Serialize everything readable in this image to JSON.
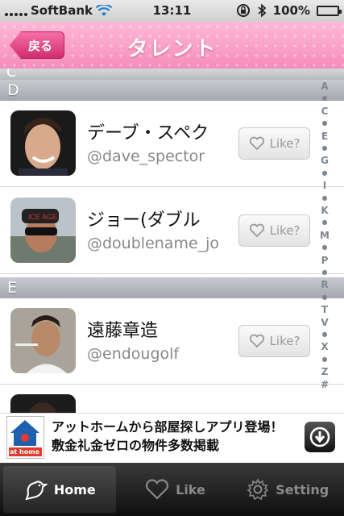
{
  "status_bar": {
    "carrier": "SoftBank",
    "time": "13:11",
    "battery": "100%"
  },
  "nav": {
    "back_label": "戻る",
    "title": "タレント"
  },
  "sections": [
    {
      "letter": "C"
    },
    {
      "letter": "D"
    },
    {
      "letter": "E"
    }
  ],
  "rows": [
    {
      "name": "デーブ・スペク",
      "handle": "@dave_spector",
      "like_label": "Like?"
    },
    {
      "name": "ジョー(ダブル",
      "handle": "@doublename_jo",
      "like_label": "Like?"
    },
    {
      "name": "遠藤章造",
      "handle": "@endougolf",
      "like_label": "Like?"
    }
  ],
  "index_letters": [
    "A",
    "●",
    "C",
    "●",
    "E",
    "●",
    "G",
    "●",
    "I",
    "●",
    "K",
    "●",
    "M",
    "●",
    "P",
    "●",
    "R",
    "●",
    "T",
    "V",
    "●",
    "X",
    "●",
    "Z",
    "#"
  ],
  "ad": {
    "text": "アットホームから部屋探しアプリ登場！敷金礼金ゼロの物件多数掲載",
    "logo_text": "at home"
  },
  "tabs": [
    {
      "label": "Home",
      "icon": "bird-icon",
      "active": true
    },
    {
      "label": "Like",
      "icon": "heart-icon",
      "active": false
    },
    {
      "label": "Setting",
      "icon": "gear-icon",
      "active": false
    }
  ],
  "colors": {
    "nav_pink": "#f58dbb",
    "back_button": "#d02d6e",
    "tab_bar": "#1a1a1a"
  }
}
